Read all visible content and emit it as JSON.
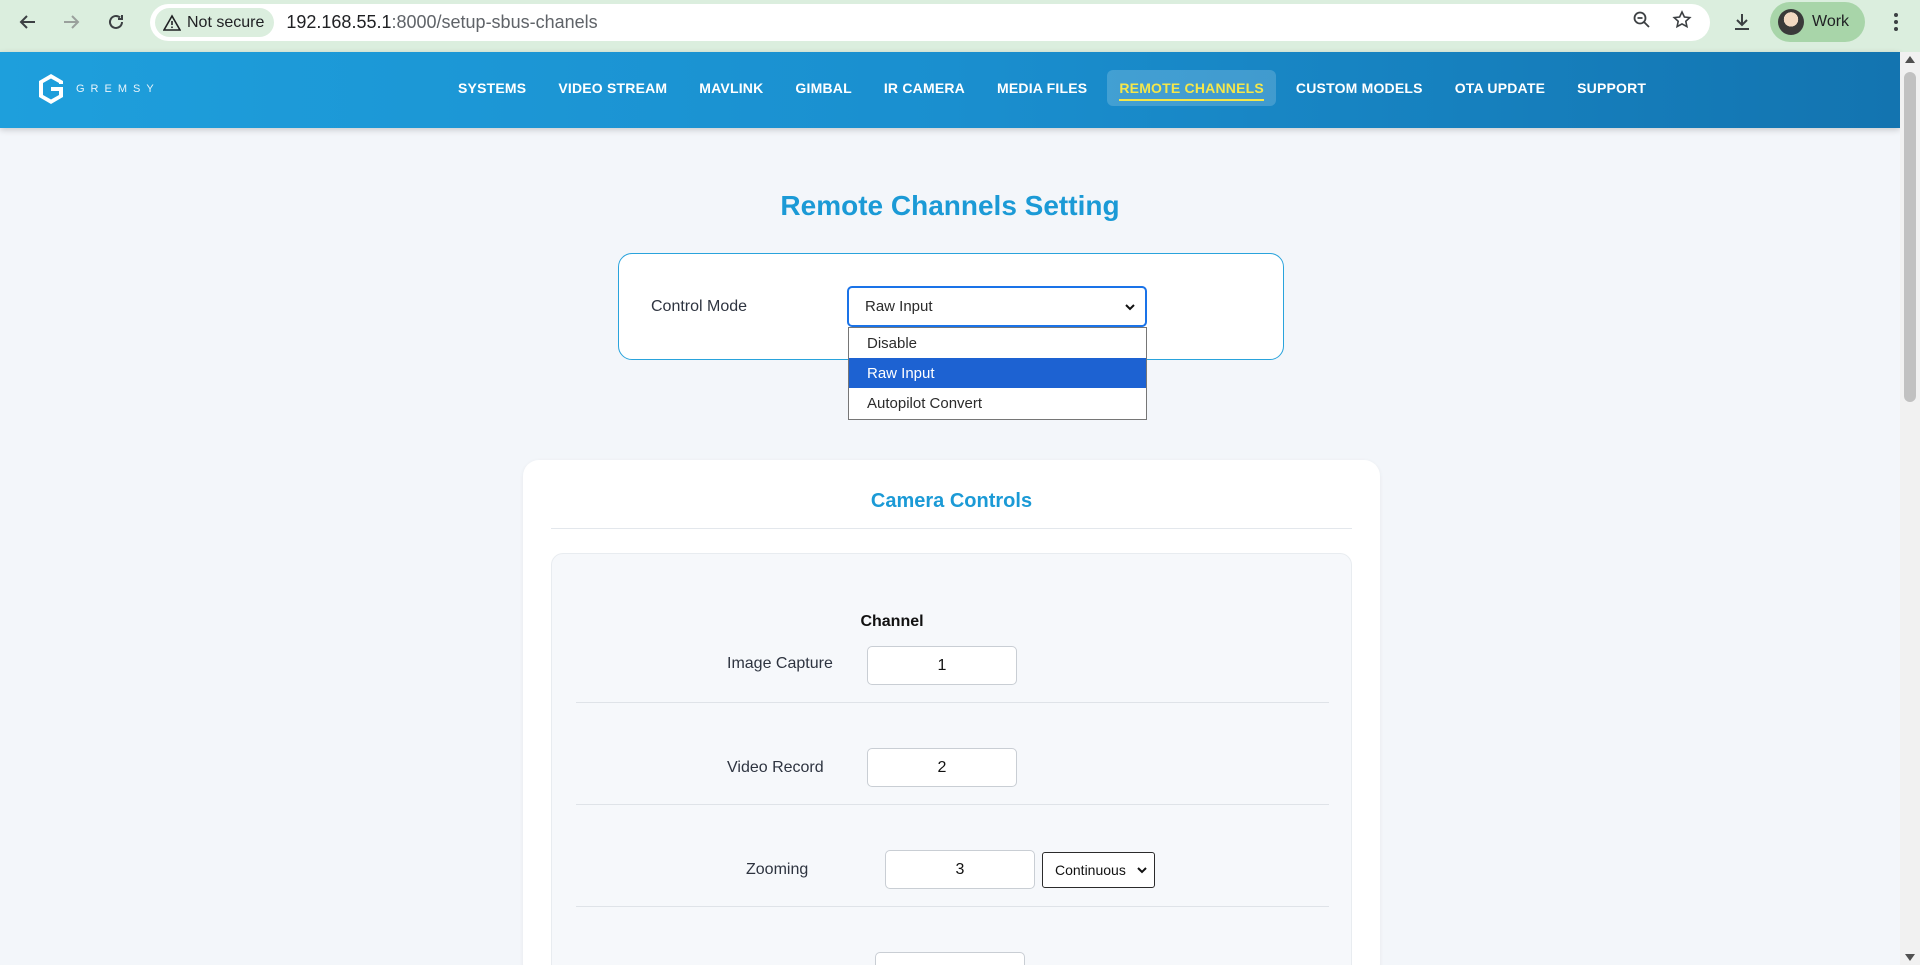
{
  "browser": {
    "security_label": "Not secure",
    "url_host": "192.168.55.1",
    "url_rest": ":8000/setup-sbus-chanels",
    "profile_name": "Work"
  },
  "header": {
    "logo_text": "GREMSY",
    "nav": [
      {
        "label": "SYSTEMS"
      },
      {
        "label": "VIDEO STREAM"
      },
      {
        "label": "MAVLINK"
      },
      {
        "label": "GIMBAL"
      },
      {
        "label": "IR CAMERA"
      },
      {
        "label": "MEDIA FILES"
      },
      {
        "label": "REMOTE CHANNELS",
        "active": true
      },
      {
        "label": "CUSTOM MODELS"
      },
      {
        "label": "OTA UPDATE"
      },
      {
        "label": "SUPPORT"
      }
    ]
  },
  "page": {
    "title": "Remote Channels Setting",
    "control_mode": {
      "label": "Control Mode",
      "value": "Raw Input",
      "options": [
        "Disable",
        "Raw Input",
        "Autopilot Convert"
      ]
    },
    "camera_controls": {
      "title": "Camera Controls",
      "channel_header": "Channel",
      "rows": [
        {
          "label": "Image Capture",
          "channel": "1"
        },
        {
          "label": "Video Record",
          "channel": "2"
        },
        {
          "label": "Zooming",
          "channel": "3",
          "mode": "Continuous"
        }
      ]
    }
  },
  "colors": {
    "accent": "#1b9ad6",
    "active_nav": "#f5e74a",
    "selected_option": "#1d62d2"
  }
}
